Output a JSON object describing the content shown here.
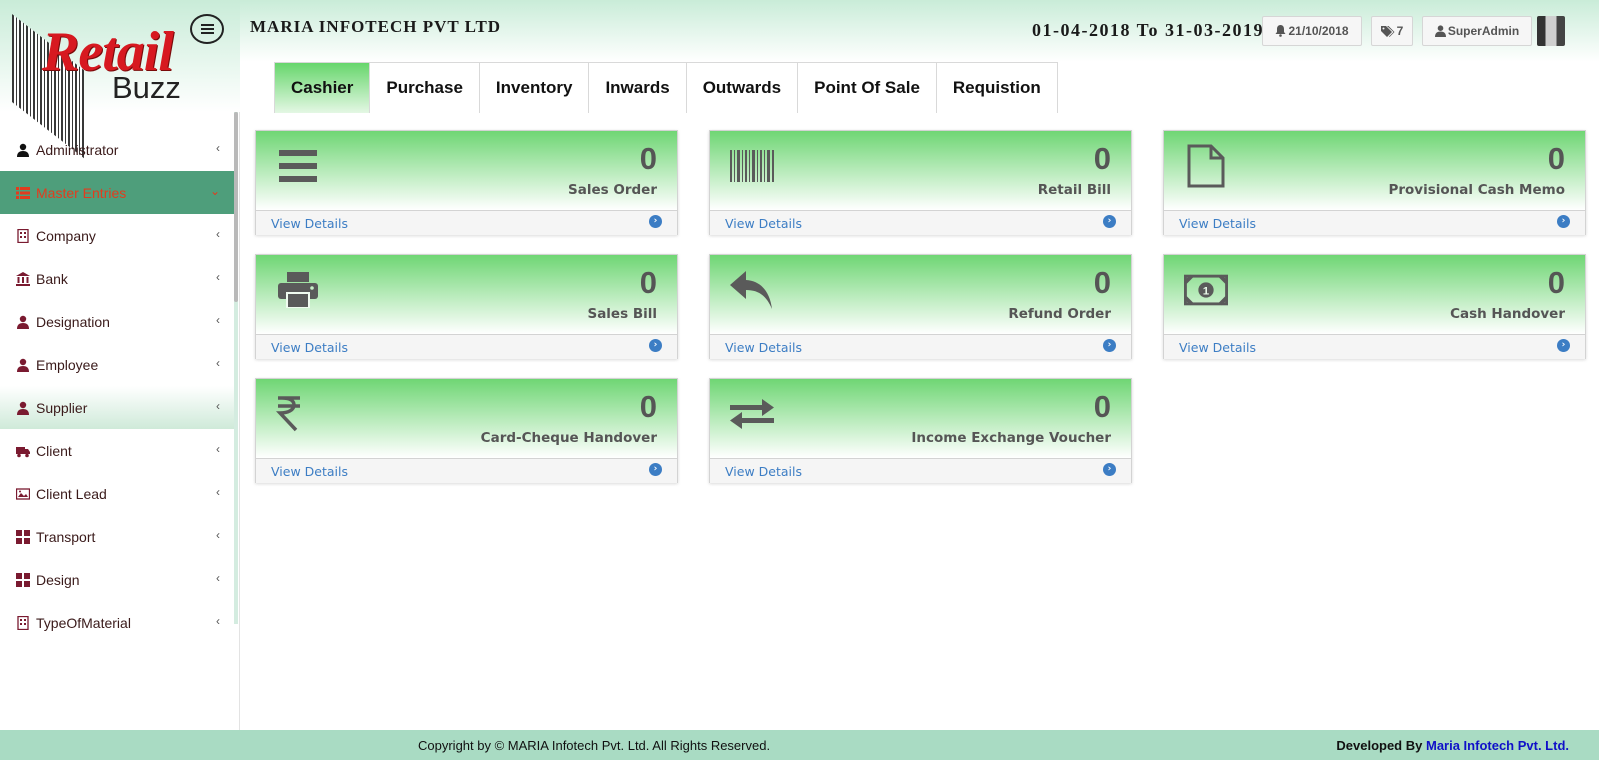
{
  "brand": {
    "logo_word1": "Retail",
    "logo_word2": "Buzz"
  },
  "header": {
    "company": "MARIA INFOTECH PVT LTD",
    "period": "01-04-2018 To 31-03-2019",
    "date_badge": "21/10/2018",
    "tag_count": "7",
    "user": "SuperAdmin"
  },
  "sidebar": {
    "items": [
      {
        "label": "Administrator",
        "icon": "user-icon"
      },
      {
        "label": "Master Entries",
        "icon": "list-icon"
      },
      {
        "label": "Company",
        "icon": "building-icon"
      },
      {
        "label": "Bank",
        "icon": "bank-icon"
      },
      {
        "label": "Designation",
        "icon": "user-icon"
      },
      {
        "label": "Employee",
        "icon": "user-icon"
      },
      {
        "label": "Supplier",
        "icon": "user-icon"
      },
      {
        "label": "Client",
        "icon": "truck-icon"
      },
      {
        "label": "Client Lead",
        "icon": "image-icon"
      },
      {
        "label": "Transport",
        "icon": "grid-icon"
      },
      {
        "label": "Design",
        "icon": "grid-icon"
      },
      {
        "label": "TypeOfMaterial",
        "icon": "building-icon"
      }
    ]
  },
  "tabs": [
    "Cashier",
    "Purchase",
    "Inventory",
    "Inwards",
    "Outwards",
    "Point Of Sale",
    "Requistion"
  ],
  "cards": [
    {
      "title": "Sales Order",
      "count": "0",
      "icon": "list-icon",
      "link": "View Details"
    },
    {
      "title": "Retail Bill",
      "count": "0",
      "icon": "barcode-icon",
      "link": "View Details"
    },
    {
      "title": "Provisional Cash Memo",
      "count": "0",
      "icon": "file-icon",
      "link": "View Details"
    },
    {
      "title": "Sales Bill",
      "count": "0",
      "icon": "printer-icon",
      "link": "View Details"
    },
    {
      "title": "Refund Order",
      "count": "0",
      "icon": "reply-icon",
      "link": "View Details"
    },
    {
      "title": "Cash Handover",
      "count": "0",
      "icon": "money-icon",
      "link": "View Details"
    },
    {
      "title": "Card-Cheque Handover",
      "count": "0",
      "icon": "rupee-icon",
      "link": "View Details"
    },
    {
      "title": "Income Exchange Voucher",
      "count": "0",
      "icon": "exchange-icon",
      "link": "View Details"
    }
  ],
  "footer": {
    "copyright": "Copyright by © MARIA Infotech Pvt. Ltd. All Rights Reserved.",
    "developed_by": "Developed By",
    "developer": "Maria Infotech Pvt. Ltd."
  },
  "colors": {
    "accent_green": "#6fd674",
    "active_nav": "#4e9e7b",
    "link_blue": "#3c7dc4",
    "footer_bg": "#a9dbc3"
  }
}
